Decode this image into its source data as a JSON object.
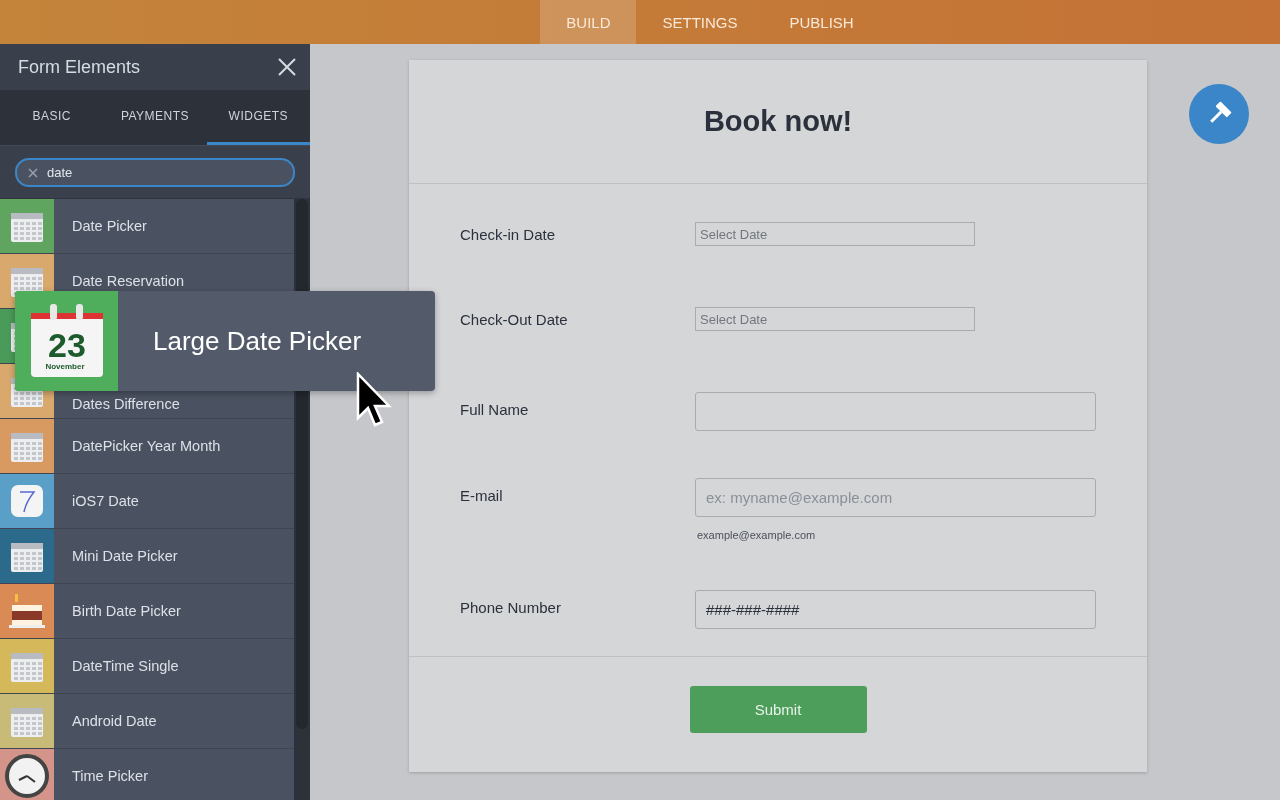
{
  "top_tabs": [
    {
      "label": "BUILD",
      "selected": true
    },
    {
      "label": "SETTINGS",
      "selected": false
    },
    {
      "label": "PUBLISH",
      "selected": false
    }
  ],
  "sidebar": {
    "title": "Form Elements",
    "tabs": [
      {
        "label": "BASIC",
        "selected": false
      },
      {
        "label": "PAYMENTS",
        "selected": false
      },
      {
        "label": "WIDGETS",
        "selected": true
      }
    ],
    "search": {
      "value": "date"
    },
    "items": [
      {
        "label": "Date Picker",
        "color": "#5fa55f",
        "kind": "calendar"
      },
      {
        "label": "Date Reservation",
        "color": "#d8a86c",
        "kind": "calendar"
      },
      {
        "color": "#4a9a5a",
        "kind": "calendar"
      },
      {
        "label": "Dates Difference",
        "color": "#d8a86c",
        "kind": "calendar"
      },
      {
        "label": "DatePicker Year Month",
        "color": "#d99a62",
        "kind": "calendar"
      },
      {
        "label": "iOS7 Date",
        "color": "#5a9fc8",
        "kind": "tile"
      },
      {
        "label": "Mini Date Picker",
        "color": "#2b6a8a",
        "kind": "calendar"
      },
      {
        "label": "Birth Date Picker",
        "color": "#d98a55",
        "kind": "cake"
      },
      {
        "label": "DateTime Single",
        "color": "#d4b85a",
        "kind": "calendar"
      },
      {
        "label": "Android Date",
        "color": "#c8bb78",
        "kind": "calendar"
      },
      {
        "label": "Time Picker",
        "color": "#d4948a",
        "kind": "clock"
      }
    ]
  },
  "dragged": {
    "label": "Large Date Picker",
    "day": "23",
    "month": "November"
  },
  "form": {
    "title": "Book now!",
    "fields": [
      {
        "label": "Check-in Date",
        "kind": "date",
        "placeholder": "Select Date"
      },
      {
        "label": "Check-Out Date",
        "kind": "date",
        "placeholder": "Select Date"
      },
      {
        "label": "Full Name",
        "kind": "text"
      },
      {
        "label": "E-mail",
        "kind": "text",
        "placeholder": "ex: myname@example.com",
        "hint": "example@example.com"
      },
      {
        "label": "Phone Number",
        "kind": "text",
        "value": "###-###-####"
      }
    ],
    "submit": "Submit"
  }
}
